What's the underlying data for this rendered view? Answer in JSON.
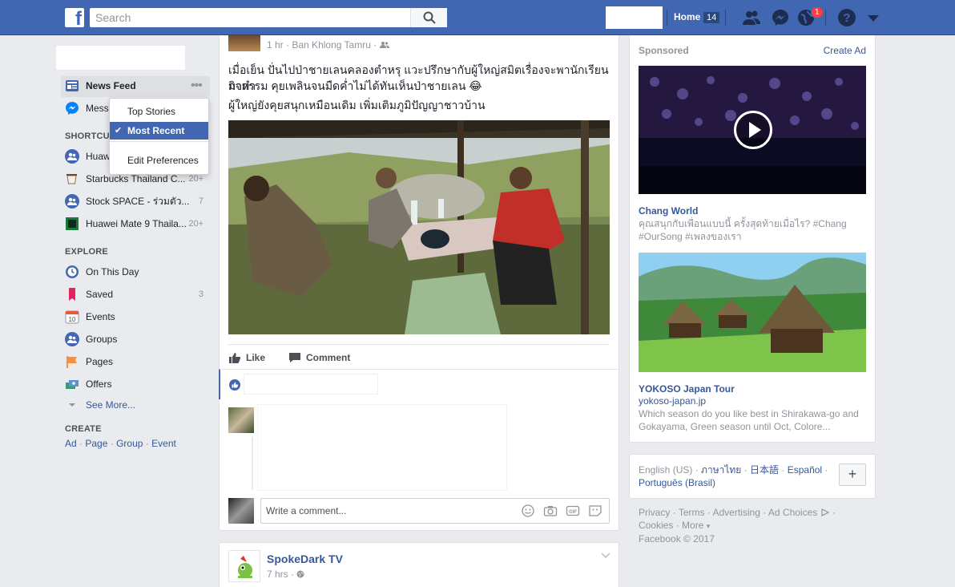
{
  "topbar": {
    "logo": "f",
    "search_placeholder": "Search",
    "home_label": "Home",
    "home_count": "14",
    "notification_count": "1"
  },
  "leftnav": {
    "news_feed": "News Feed",
    "messenger": "Messe",
    "shortcuts_header": "SHORTCU",
    "shortcuts": [
      {
        "label": "Huaw",
        "count": ""
      },
      {
        "label": "Starbucks Thailand C...",
        "count": "20+"
      },
      {
        "label": "Stock SPACE - ร่วมตัว...",
        "count": "7"
      },
      {
        "label": "Huawei Mate 9 Thaila...",
        "count": "20+"
      }
    ],
    "explore_header": "EXPLORE",
    "explore": [
      {
        "label": "On This Day",
        "count": "",
        "icon": "clock-icon"
      },
      {
        "label": "Saved",
        "count": "3",
        "icon": "bookmark-icon"
      },
      {
        "label": "Events",
        "count": "",
        "icon": "calendar-icon",
        "icon_text": "10"
      },
      {
        "label": "Groups",
        "count": "",
        "icon": "groups-icon"
      },
      {
        "label": "Pages",
        "count": "",
        "icon": "flag-icon"
      },
      {
        "label": "Offers",
        "count": "",
        "icon": "offers-icon"
      }
    ],
    "see_more": "See More...",
    "create_header": "CREATE",
    "create_links": [
      "Ad",
      "Page",
      "Group",
      "Event"
    ]
  },
  "dropdown": {
    "items": [
      "Top Stories",
      "Most Recent",
      "Edit Preferences"
    ],
    "selected": "Most Recent"
  },
  "post": {
    "meta_time": "1 hr",
    "meta_sep": "·",
    "meta_location": "Ban Khlong Tamru",
    "meta_sep2": "·",
    "text_line1": "เมื่อเย็น ปั่นไปป่าชายเลนคลองตำหรุ แวะปรึกษากับผู้ใหญ่สมิตเรื่องจะพานักเรียนมาทำ",
    "text_line2": "กิจกรรม คุยเพลินจนมืดค่ำไม่ได้ทันเห็นป่าชายเลน 😂",
    "text_line3": "ผู้ใหญ่ยังคุยสนุกเหมือนเดิม เพิ่มเติมภูมิปัญญาชาวบ้าน",
    "like_label": "Like",
    "comment_label": "Comment",
    "write_comment_placeholder": "Write a comment..."
  },
  "post2": {
    "name": "SpokeDark TV",
    "time": "7 hrs",
    "sep": "·"
  },
  "sponsored": {
    "header": "Sponsored",
    "create_ad": "Create Ad",
    "ads": [
      {
        "title": "Chang World",
        "body": "คุณสนุกกับเพื่อนแบบนี้ ครั้งสุดท้ายเมื่อไร? #Chang #OurSong #เพลงของเรา"
      },
      {
        "title": "YOKOSO Japan Tour",
        "url": "yokoso-japan.jp",
        "body": "Which season do you like best in Shirakawa-go and Gokayama, Green season until Oct, Colore..."
      }
    ]
  },
  "languages": {
    "current": "English (US)",
    "sep": "·",
    "links": [
      "ภาษาไทย",
      "日本語",
      "Español",
      "Português (Brasil)"
    ],
    "plus": "+"
  },
  "footer": {
    "links": [
      "Privacy",
      "Terms",
      "Advertising",
      "Ad Choices"
    ],
    "line2": [
      "Cookies",
      "More"
    ],
    "more_arrow": "▾",
    "sep": "·",
    "copyright": "Facebook © 2017"
  },
  "colors": {
    "brand": "#4267b2",
    "link": "#365899",
    "muted": "#90949c",
    "badge": "#fa3e3e"
  }
}
